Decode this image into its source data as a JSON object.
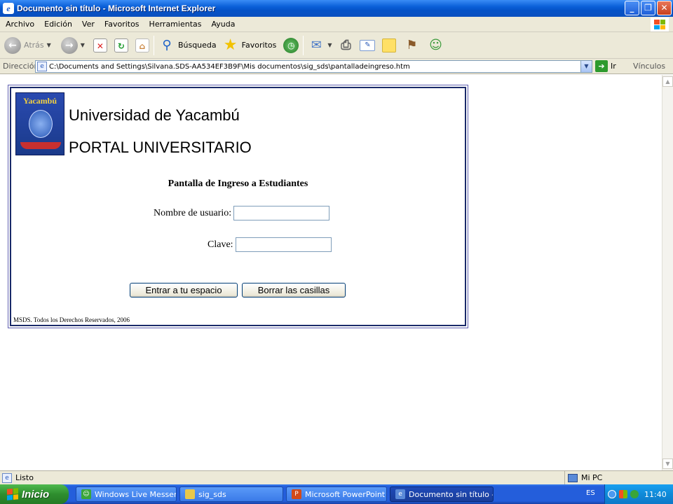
{
  "window": {
    "title": "Documento sin título - Microsoft Internet Explorer",
    "app_icon": "ie-icon",
    "controls": {
      "minimize": "_",
      "maximize": "❐",
      "close": "✕"
    }
  },
  "menu": [
    "Archivo",
    "Edición",
    "Ver",
    "Favoritos",
    "Herramientas",
    "Ayuda"
  ],
  "toolbar": {
    "back_label": "Atrás",
    "search_label": "Búsqueda",
    "favorites_label": "Favoritos"
  },
  "addressbar": {
    "label": "Dirección",
    "url": "C:\\Documents and Settings\\Silvana.SDS-AA534EF3B9F\\Mis documentos\\sig_sds\\pantalladeingreso.htm",
    "go_label": "Ir",
    "links_label": "Vínculos"
  },
  "page": {
    "logo_text": "Yacambú",
    "university_name": "Universidad de Yacambú",
    "portal_title": "PORTAL UNIVERSITARIO",
    "screen_title": "Pantalla de Ingreso a Estudiantes",
    "username_label": "Nombre de usuario:",
    "username_value": "",
    "password_label": "Clave:",
    "password_value": "",
    "enter_button": "Entrar a tu espacio",
    "clear_button": "Borrar las casillas",
    "footer": "MSDS. Todos los Derechos Reservados, 2006"
  },
  "statusbar": {
    "status": "Listo",
    "zone": "Mi PC"
  },
  "taskbar": {
    "start_label": "Inicio",
    "tasks": [
      {
        "label": "Windows Live Messen...",
        "icon": "msn-icon",
        "active": false
      },
      {
        "label": "sig_sds",
        "icon": "folder-icon",
        "active": false
      },
      {
        "label": "Microsoft PowerPoint ...",
        "icon": "powerpoint-icon",
        "active": false
      },
      {
        "label": "Documento sin título -...",
        "icon": "ie-icon",
        "active": true
      }
    ],
    "language": "ES",
    "clock": "11:40"
  },
  "colors": {
    "titlebar": "#0553c8",
    "chrome": "#ece9d8",
    "taskbar": "#245edb",
    "start": "#2e8e2e",
    "frame_border": "#1a2a6a"
  }
}
